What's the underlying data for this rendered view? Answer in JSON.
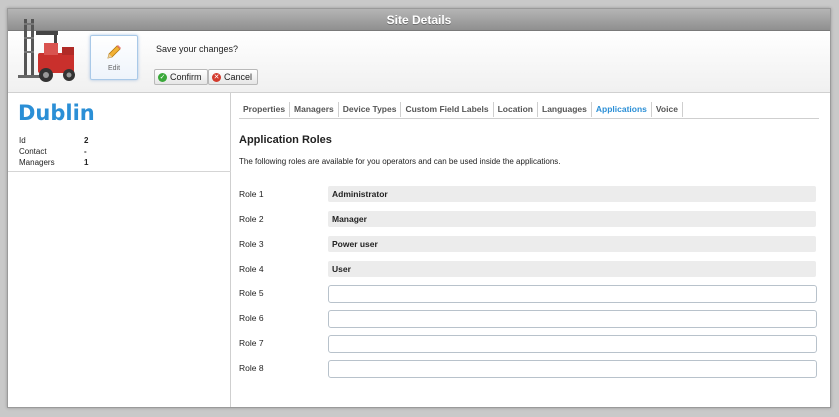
{
  "window": {
    "title": "Site Details"
  },
  "toolbar": {
    "edit_label": "Edit",
    "save_prompt": "Save your changes?",
    "confirm_label": "Confirm",
    "cancel_label": "Cancel"
  },
  "site": {
    "name": "Dublin",
    "fields": [
      {
        "key": "Id",
        "value": "2"
      },
      {
        "key": "Contact",
        "value": "-"
      },
      {
        "key": "Managers",
        "value": "1"
      }
    ]
  },
  "tabs": [
    {
      "label": "Properties",
      "active": false
    },
    {
      "label": "Managers",
      "active": false
    },
    {
      "label": "Device Types",
      "active": false
    },
    {
      "label": "Custom Field Labels",
      "active": false
    },
    {
      "label": "Location",
      "active": false
    },
    {
      "label": "Languages",
      "active": false
    },
    {
      "label": "Applications",
      "active": true
    },
    {
      "label": "Voice",
      "active": false
    }
  ],
  "section": {
    "title": "Application Roles",
    "description": "The following roles are available for you operators and can be used inside the applications."
  },
  "roles": [
    {
      "label": "Role 1",
      "value": "Administrator",
      "editable": false
    },
    {
      "label": "Role 2",
      "value": "Manager",
      "editable": false
    },
    {
      "label": "Role 3",
      "value": "Power user",
      "editable": false
    },
    {
      "label": "Role 4",
      "value": "User",
      "editable": false
    },
    {
      "label": "Role 5",
      "value": "",
      "editable": true
    },
    {
      "label": "Role 6",
      "value": "",
      "editable": true
    },
    {
      "label": "Role 7",
      "value": "",
      "editable": true
    },
    {
      "label": "Role 8",
      "value": "",
      "editable": true
    }
  ],
  "colors": {
    "accent": "#2b8fd6",
    "confirm": "#3aa839",
    "cancel": "#d33a2c"
  },
  "icons": {
    "logo": "forklift-icon",
    "edit": "pencil-icon",
    "confirm": "check-icon",
    "cancel": "close-icon"
  }
}
